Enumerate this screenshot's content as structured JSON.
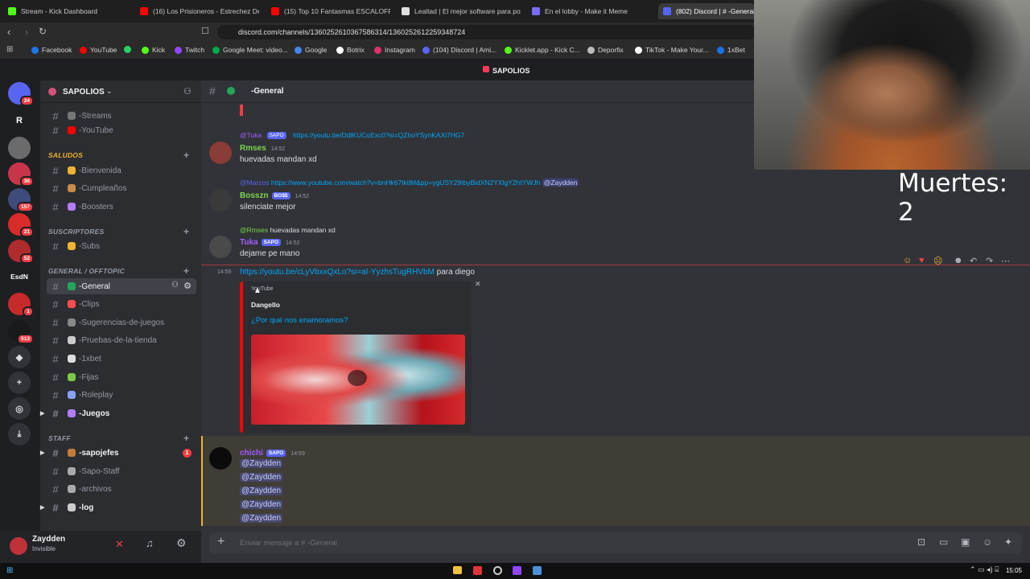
{
  "browser": {
    "tabs": [
      {
        "label": "Stream - Kick Dashboard",
        "color": "#53fc18"
      },
      {
        "label": "(16) Los Prisioneros - Estrechez De Co",
        "color": "#ff0000"
      },
      {
        "label": "(15) Top 10 Fantasmas ESCALOFRIAN",
        "color": "#ff0000"
      },
      {
        "label": "Lealtad | El mejor software para pote",
        "color": "#e0e0e0"
      },
      {
        "label": "En el lobby - Make it Meme",
        "color": "#7a6cff"
      },
      {
        "label": "(802) Discord | # -General",
        "color": "#5865f2"
      }
    ],
    "url": "discord.com/channels/1360252610367586314/1360252612259348724",
    "bookmarks": [
      {
        "label": "Facebook",
        "color": "#1877f2"
      },
      {
        "label": "YouTube",
        "color": "#ff0000"
      },
      {
        "label": "Kick",
        "color": "#53fc18"
      },
      {
        "label": "Twitch",
        "color": "#9146ff"
      },
      {
        "label": "Google Meet: video...",
        "color": "#00ac47"
      },
      {
        "label": "Google",
        "color": "#4285f4"
      },
      {
        "label": "Botrix",
        "color": "#ffffff"
      },
      {
        "label": "Instagram",
        "color": "#e1306c"
      },
      {
        "label": "(104) Discord | Ami...",
        "color": "#5865f2"
      },
      {
        "label": "Kicklet.app - Kick C...",
        "color": "#53fc18"
      },
      {
        "label": "Deporfix",
        "color": "#bbbbbb"
      },
      {
        "label": "TikTok - Make Your...",
        "color": "#ffffff"
      },
      {
        "label": "1xBet",
        "color": "#1a73e8"
      }
    ]
  },
  "banner": {
    "server_title": "SAPOLIOS"
  },
  "rail": {
    "items": [
      {
        "label": "",
        "badge": "24",
        "color": "#5865f2"
      },
      {
        "label": "R",
        "badge": "",
        "color": "#1e1f22"
      },
      {
        "label": "",
        "badge": "",
        "color": "#6b6b6b"
      },
      {
        "label": "",
        "badge": "36",
        "color": "#c7354a"
      },
      {
        "label": "",
        "badge": "157",
        "color": "#3d4c7a"
      },
      {
        "label": "",
        "badge": "21",
        "color": "#d92b2b"
      },
      {
        "label": "",
        "badge": "52",
        "color": "#b02b2b"
      },
      {
        "label": "EsdN",
        "badge": "",
        "color": "#1e1f22"
      },
      {
        "label": "",
        "badge": "1",
        "color": "#c72a2a"
      },
      {
        "label": "",
        "badge": "513",
        "color": "#1a1a1a"
      }
    ]
  },
  "sidebar": {
    "server_name": "SAPOLIOS",
    "categories": [
      {
        "label": "SALUDOS",
        "color": "#f0b232"
      },
      {
        "label": "SUSCRIPTORES",
        "color": "#949ba4"
      },
      {
        "label": "GENERAL / OFFTOPIC",
        "color": "#949ba4"
      },
      {
        "label": "STAFF",
        "color": "#949ba4"
      }
    ],
    "channels": [
      {
        "label": "-Streams",
        "emoji_color": "#777777"
      },
      {
        "label": "-YouTube",
        "emoji_color": "#ff0000"
      },
      {
        "label": "-Bienvenida",
        "emoji_color": "#f0b232"
      },
      {
        "label": "-Cumpleaños",
        "emoji_color": "#c98a4a"
      },
      {
        "label": "-Boosters",
        "emoji_color": "#b57bff"
      },
      {
        "label": "-Subs",
        "emoji_color": "#f0b232"
      },
      {
        "label": "-General",
        "emoji_color": "#23a55a"
      },
      {
        "label": "-Clips",
        "emoji_color": "#ff4d4d"
      },
      {
        "label": "-Sugerencias-de-juegos",
        "emoji_color": "#888888"
      },
      {
        "label": "-Pruebas-de-la-tienda",
        "emoji_color": "#cccccc"
      },
      {
        "label": "-1xbet",
        "emoji_color": "#dddddd"
      },
      {
        "label": "-Fijas",
        "emoji_color": "#7bc94a"
      },
      {
        "label": "-Roleplay",
        "emoji_color": "#8aa0ff"
      },
      {
        "label": "-Juegos",
        "emoji_color": "#b57bff"
      },
      {
        "label": "-sapojefes",
        "emoji_color": "#c47b3a",
        "badge": "1"
      },
      {
        "label": "-Sapo-Staff",
        "emoji_color": "#aaaaaa"
      },
      {
        "label": "-archivos",
        "emoji_color": "#aaaaaa"
      },
      {
        "label": "-log",
        "emoji_color": "#cccccc"
      }
    ]
  },
  "user": {
    "name": "Zaydden",
    "status": "Invisible"
  },
  "chat": {
    "channel_title": "-General",
    "messages": [
      {
        "reply_prefix": "@Tuka",
        "reply_tag": "SAPO",
        "reply_text": "https://youtu.be/DdlKUCoExc0?si=QZhoYSynKAXi7HG7",
        "author": "Rmses",
        "time": "14:52",
        "text": "huevadas mandan xd",
        "color": "#7bd64a"
      },
      {
        "reply_prefix": "@Marcos",
        "reply_text": "https://www.youtube.com/watch?v=bnHk67tktlM&pp=ygUSY29tbyBidXN2YXlgY2htYWJh",
        "reply_mention": "@Zaydden",
        "author": "Bosszn",
        "tag": "BO$$",
        "time": "14:52",
        "text": "silenciate mejor",
        "color": "#7bd64a"
      },
      {
        "reply_prefix": "@Rmses",
        "reply_text": "huevadas mandan xd",
        "author": "Tuka",
        "tag": "SAPO",
        "time": "14:52",
        "text": "dejame pe mano",
        "color": "#a35cff"
      },
      {
        "time": "14:55",
        "link": "https://youtu.be/cLyVbxxQxLo?si=aI-YyzhsTugRHVbM",
        "text": " para diego"
      }
    ],
    "embed": {
      "provider": "YouTube",
      "author": "Dangello",
      "title": "¿Por qué nos enamoramos?"
    },
    "mention_msg": {
      "author": "chichi",
      "tag": "SAPO",
      "time": "14:59",
      "mentions": [
        "@Zaydden",
        "@Zaydden",
        "@Zaydden",
        "@Zaydden",
        "@Zaydden"
      ]
    },
    "composer_placeholder": "Enviar mensaje a # -General"
  },
  "overlay": {
    "death_counter": "Muertes: 2"
  },
  "taskbar": {
    "time": "15:05"
  }
}
